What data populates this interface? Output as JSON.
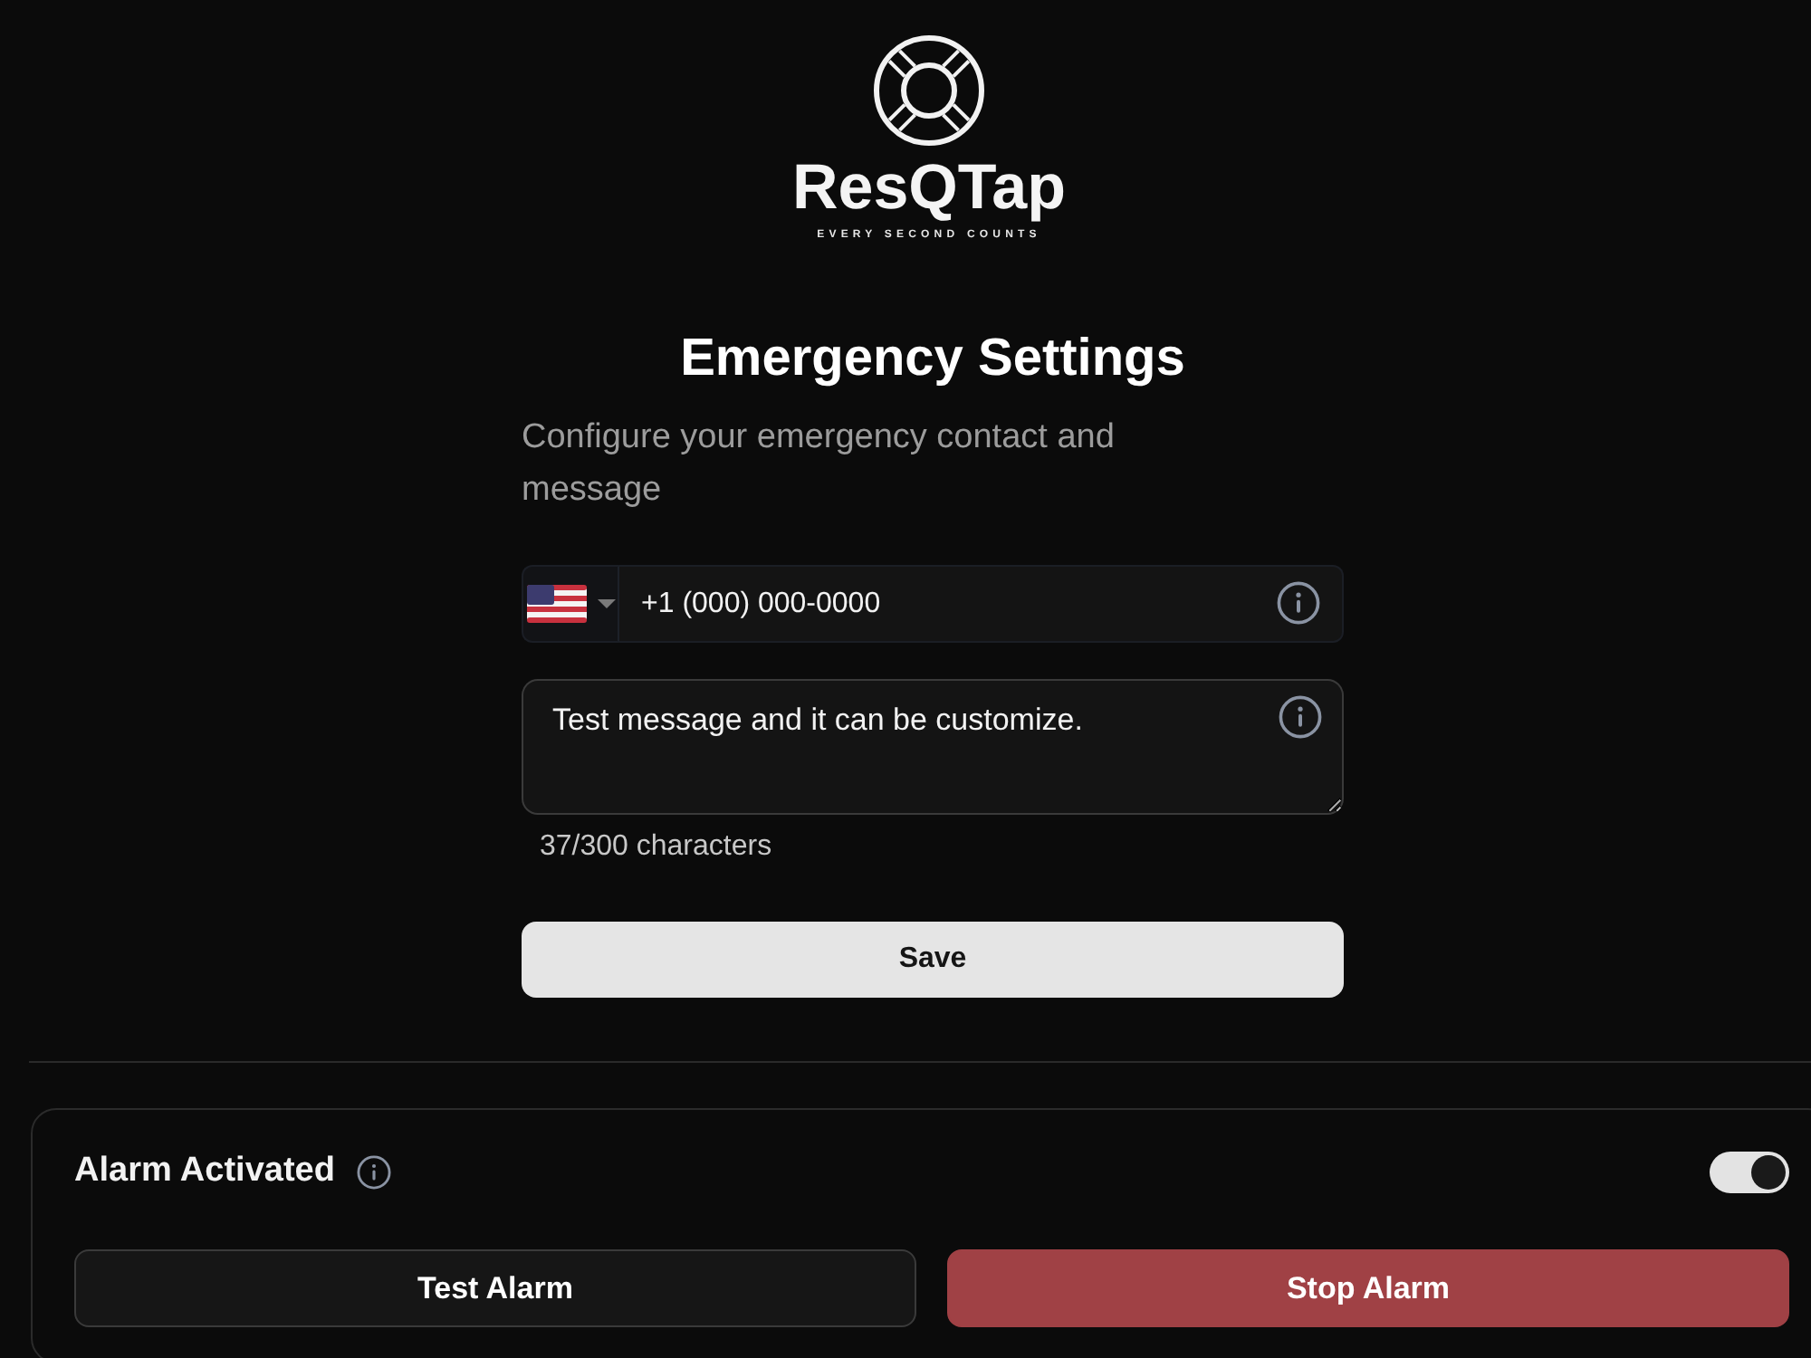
{
  "logo": {
    "name": "ResQTap",
    "tagline": "EVERY SECOND COUNTS"
  },
  "header": {
    "title": "Emergency Settings",
    "subtitle": "Configure your emergency contact and message"
  },
  "phone_field": {
    "value": "+1 (000) 000-0000"
  },
  "message_field": {
    "value": "Test message and it can be customize.",
    "counter": "37/300 characters"
  },
  "save_button": {
    "label": "Save"
  },
  "alarm": {
    "label": "Alarm Activated",
    "on": true,
    "buttons": [
      {
        "label": "Test Alarm",
        "kind": "secondary"
      },
      {
        "label": "Stop Alarm",
        "kind": "danger"
      }
    ]
  }
}
